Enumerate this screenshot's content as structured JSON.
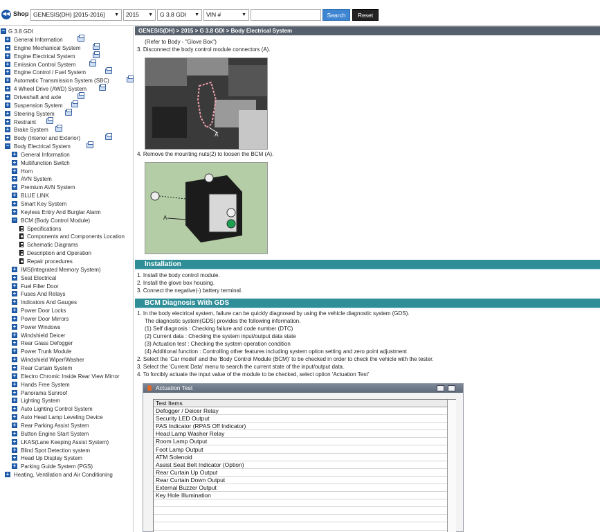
{
  "toolbar": {
    "back_label": "◀◀",
    "shop_label": "Shop",
    "model_select": "GENESIS(DH) [2015-2016]",
    "year_select": "2015",
    "engine_select": "G 3.8 GDI",
    "vin_select": "VIN #",
    "vin_input_value": "",
    "search_label": "Search",
    "reset_label": "Reset"
  },
  "sidebar": {
    "root_label": "G 3.8 GDI",
    "items": [
      {
        "label": "General Information",
        "level": 1,
        "icon": "plus",
        "printer": true
      },
      {
        "label": "Engine Mechanical System",
        "level": 1,
        "icon": "plus",
        "printer": true
      },
      {
        "label": "Engine Electrical System",
        "level": 1,
        "icon": "plus",
        "printer": true
      },
      {
        "label": "Emission Control System",
        "level": 1,
        "icon": "plus",
        "printer": true
      },
      {
        "label": "Engine Control / Fuel System",
        "level": 1,
        "icon": "plus",
        "printer": true
      },
      {
        "label": "Automatic Transmission System (SBC)",
        "level": 1,
        "icon": "plus",
        "printer": true
      },
      {
        "label": "4 Wheel Drive (AWD) System",
        "level": 1,
        "icon": "plus",
        "printer": true
      },
      {
        "label": "Driveshaft and axle",
        "level": 1,
        "icon": "plus",
        "printer": true
      },
      {
        "label": "Suspension System",
        "level": 1,
        "icon": "plus",
        "printer": true
      },
      {
        "label": "Steering System",
        "level": 1,
        "icon": "plus",
        "printer": true
      },
      {
        "label": "Restraint",
        "level": 1,
        "icon": "plus",
        "printer": true
      },
      {
        "label": "Brake System",
        "level": 1,
        "icon": "plus",
        "printer": true
      },
      {
        "label": "Body (Interior and Exterior)",
        "level": 1,
        "icon": "plus",
        "printer": true
      },
      {
        "label": "Body Electrical System",
        "level": 1,
        "icon": "minus",
        "printer": true
      },
      {
        "label": "General Information",
        "level": 2,
        "icon": "plus",
        "printer": false
      },
      {
        "label": "Multifunction Switch",
        "level": 2,
        "icon": "plus",
        "printer": false
      },
      {
        "label": "Horn",
        "level": 2,
        "icon": "plus",
        "printer": false
      },
      {
        "label": "AVN System",
        "level": 2,
        "icon": "plus",
        "printer": false
      },
      {
        "label": "Premium AVN System",
        "level": 2,
        "icon": "plus",
        "printer": false
      },
      {
        "label": "BLUE LINK",
        "level": 2,
        "icon": "plus",
        "printer": false
      },
      {
        "label": "Smart Key System",
        "level": 2,
        "icon": "plus",
        "printer": false
      },
      {
        "label": "Keyless Entry And Burglar Alarm",
        "level": 2,
        "icon": "plus",
        "printer": false
      },
      {
        "label": "BCM (Body Control Module)",
        "level": 2,
        "icon": "minus",
        "printer": false
      },
      {
        "label": "Specifications",
        "level": 3,
        "icon": "doc",
        "printer": false
      },
      {
        "label": "Components and Components Location",
        "level": 3,
        "icon": "doc",
        "printer": false
      },
      {
        "label": "Schematic Diagrams",
        "level": 3,
        "icon": "doc",
        "printer": false
      },
      {
        "label": "Description and Operation",
        "level": 3,
        "icon": "doc",
        "printer": false
      },
      {
        "label": "Repair procedures",
        "level": 3,
        "icon": "doc",
        "printer": false
      },
      {
        "label": "IMS(Integrated Memory System)",
        "level": 2,
        "icon": "plus",
        "printer": false
      },
      {
        "label": "Seat Electrical",
        "level": 2,
        "icon": "plus",
        "printer": false
      },
      {
        "label": "Fuel Filler Door",
        "level": 2,
        "icon": "plus",
        "printer": false
      },
      {
        "label": "Fuses And Relays",
        "level": 2,
        "icon": "plus",
        "printer": false
      },
      {
        "label": "Indicators And Gauges",
        "level": 2,
        "icon": "plus",
        "printer": false
      },
      {
        "label": "Power Door Locks",
        "level": 2,
        "icon": "plus",
        "printer": false
      },
      {
        "label": "Power Door Mirrors",
        "level": 2,
        "icon": "plus",
        "printer": false
      },
      {
        "label": "Power Windows",
        "level": 2,
        "icon": "plus",
        "printer": false
      },
      {
        "label": "Windshield Deicer",
        "level": 2,
        "icon": "plus",
        "printer": false
      },
      {
        "label": "Rear Glass Defogger",
        "level": 2,
        "icon": "plus",
        "printer": false
      },
      {
        "label": "Power Trunk Module",
        "level": 2,
        "icon": "plus",
        "printer": false
      },
      {
        "label": "Windshield Wiper/Washer",
        "level": 2,
        "icon": "plus",
        "printer": false
      },
      {
        "label": "Rear Curtain System",
        "level": 2,
        "icon": "plus",
        "printer": false
      },
      {
        "label": "Electro Chromic Inside Rear View Mirror",
        "level": 2,
        "icon": "plus",
        "printer": false
      },
      {
        "label": "Hands Free System",
        "level": 2,
        "icon": "plus",
        "printer": false
      },
      {
        "label": "Panorama Sunroof",
        "level": 2,
        "icon": "plus",
        "printer": false
      },
      {
        "label": "Lighting System",
        "level": 2,
        "icon": "plus",
        "printer": false
      },
      {
        "label": "Auto Lighting Control System",
        "level": 2,
        "icon": "plus",
        "printer": false
      },
      {
        "label": "Auto Head Lamp Leveling Device",
        "level": 2,
        "icon": "plus",
        "printer": false
      },
      {
        "label": "Rear Parking Assist System",
        "level": 2,
        "icon": "plus",
        "printer": false
      },
      {
        "label": "Button Engine Start System",
        "level": 2,
        "icon": "plus",
        "printer": false
      },
      {
        "label": "LKAS(Lane Keeping Assist System)",
        "level": 2,
        "icon": "plus",
        "printer": false
      },
      {
        "label": "Blind Spot Detection system",
        "level": 2,
        "icon": "plus",
        "printer": false
      },
      {
        "label": "Head Up Display System",
        "level": 2,
        "icon": "plus",
        "printer": false
      },
      {
        "label": "Parking Guide System (PGS)",
        "level": 2,
        "icon": "plus",
        "printer": false
      },
      {
        "label": "Heating, Ventilation and Air Conditioning",
        "level": 1,
        "icon": "plus",
        "printer": true
      }
    ]
  },
  "main": {
    "breadcrumb": "GENESIS(DH) > 2015 > G 3.8 GDI > Body Electrical System",
    "removal_lines": [
      "(Refer to Body - \"Glove Box\")",
      "3.  Disconnect the body control module connectors (A).",
      "4.  Remove the mounting nuts(2) to loosen the BCM (A)."
    ],
    "photo1_label": "A",
    "photo2_label": "A",
    "installation": {
      "title": "Installation",
      "lines": [
        "1.  Install the body control module.",
        "2.  Install the glove box housing.",
        "3.  Connect the negative(-) battery terminal."
      ]
    },
    "gds": {
      "title": "BCM Diagnosis With GDS",
      "lines": [
        "1.  In the body electrical system, failure can be quickly diagnosed by using the vehicle diagnostic system (GDS).",
        "The diagnostic system(GDS) provides the following information.",
        "(1) Self diagnosis : Checking failure and code number (DTC)",
        "(2) Current data : Checking the system input/output data state",
        "(3) Actuation test : Checking the system operation condition",
        "(4) Additional function : Controlling other features including system option setting and zero point adjustment",
        "2.  Select the 'Car model' and the 'Body Control Module (BCM)' to be checked in order to check the vehicle with the tester.",
        "3.  Select the 'Current Data' menu to search the current state of the input/output data.",
        "4.  To forcibly actuate the input value of the module to be checked, select option 'Actuation Test'"
      ]
    },
    "actuation": {
      "window_title": "Actuation Test",
      "header": "Test Items",
      "rows": [
        "Defogger / Deicer Relay",
        "Security LED Output",
        "PAS Indicator (RPAS Off Indicator)",
        "Head Lamp Washer Relay",
        "Room Lamp Output",
        "Foot Lamp Output",
        "ATM Solenoid",
        "Assist Seat Belt Indicator (Option)",
        "Rear Curtain Up Output",
        "Rear Curtain Down Output",
        "External Buzzer Output",
        "Key Hole Illumination"
      ]
    }
  }
}
